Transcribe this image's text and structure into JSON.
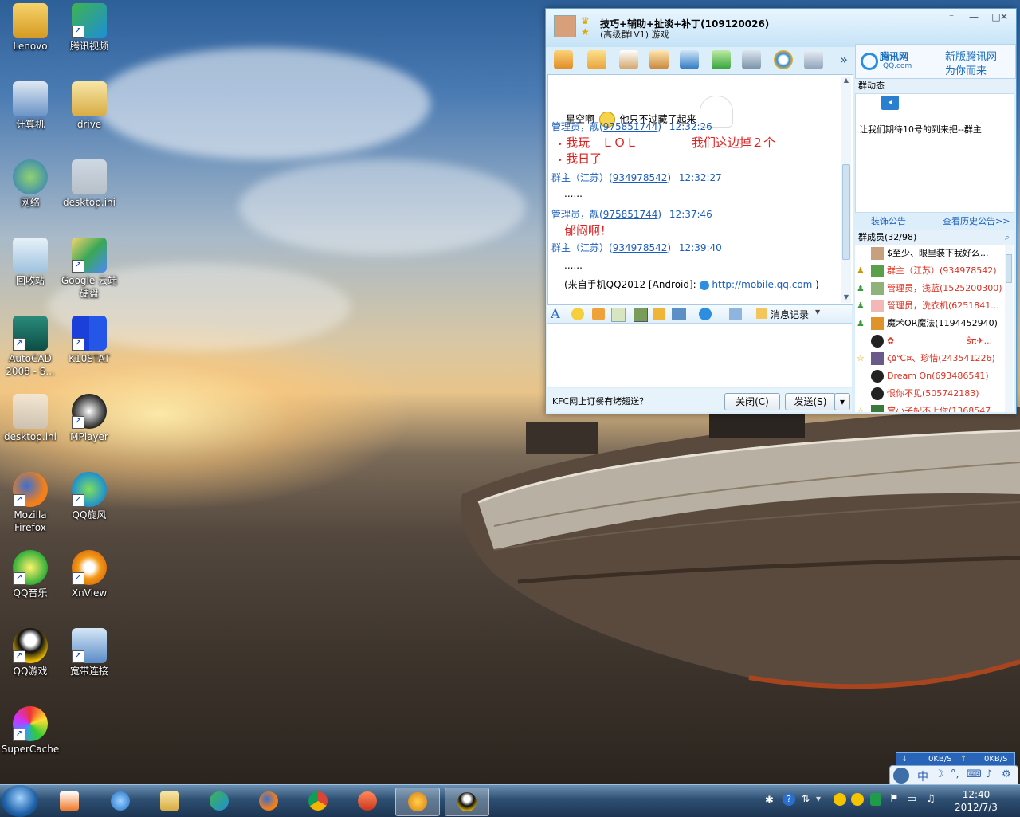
{
  "desktop": {
    "icons": [
      {
        "label": "Lenovo",
        "icon": "user-folder-icon"
      },
      {
        "label": "腾讯视频",
        "icon": "tencent-video-icon"
      },
      {
        "label": "计算机",
        "icon": "computer-icon"
      },
      {
        "label": "drive",
        "icon": "folder-icon"
      },
      {
        "label": "网络",
        "icon": "network-globe-icon"
      },
      {
        "label": "desktop.ini",
        "icon": "settings-file-icon"
      },
      {
        "label": "回收站",
        "icon": "recycle-bin-icon"
      },
      {
        "label": "Google 云端\n硬盘",
        "icon": "google-drive-icon"
      },
      {
        "label": "AutoCAD\n2008 - S...",
        "icon": "autocad-icon"
      },
      {
        "label": "K10STAT",
        "icon": "k10stat-icon"
      },
      {
        "label": "desktop.ini",
        "icon": "settings-file-icon"
      },
      {
        "label": "MPlayer",
        "icon": "mplayer-icon"
      },
      {
        "label": "Mozilla\nFirefox",
        "icon": "firefox-icon"
      },
      {
        "label": "QQ旋风",
        "icon": "qq-whirlwind-icon"
      },
      {
        "label": "QQ音乐",
        "icon": "qq-music-icon"
      },
      {
        "label": "XnView",
        "icon": "xnview-icon"
      },
      {
        "label": "QQ游戏",
        "icon": "qq-game-icon"
      },
      {
        "label": "宽带连接",
        "icon": "broadband-icon"
      },
      {
        "label": "SuperCache",
        "icon": "supercache-icon"
      }
    ]
  },
  "qq": {
    "group_name": "技巧+辅助+扯淡+补丁(109120026)",
    "group_sub": "(高级群LV1) 游戏",
    "chat": {
      "line1_name": "星空啊",
      "line1_text": "他只不过藏了起来",
      "m1_name": "管理员，靓(",
      "m1_uid": "975851744",
      "m1_close": ")",
      "m1_time": "12:32:26",
      "m1_text_a": "我玩　ＬＯＬ",
      "m1_text_b": "我们这边掉２个",
      "m1_text_c": "我日了",
      "m2_name": "群主（江苏）(",
      "m2_uid": "934978542",
      "m2_close": ")",
      "m2_time": "12:32:27",
      "m2_text": "......",
      "m3_name": "管理员，靓(",
      "m3_uid": "975851744",
      "m3_close": ")",
      "m3_time": "12:37:46",
      "m3_text": "郁闷啊！",
      "m4_name": "群主（江苏）(",
      "m4_uid": "934978542",
      "m4_close": ")",
      "m4_time": "12:39:40",
      "m4_text": "......",
      "m4_src": "(来自手机QQ2012 [Android]:",
      "m4_link": "http://mobile.qq.com",
      "m4_end": ")"
    },
    "fmt_history": "消息记录",
    "bottom_ad": "KFC网上订餐有烤翅送？",
    "close_btn": "关闭(C)",
    "send_btn": "发送(S)",
    "ad_line1": "新版腾讯网",
    "ad_line2": "为你而来",
    "ad_logo": "腾讯网",
    "ad_logo_sub": "QQ.com",
    "notice_header": "群动态",
    "notice_text": "让我们期待10号的到来把--群主",
    "decor_link": "装饰公告",
    "history_link": "查看历史公告>>",
    "members_header": "群成员(32/98)",
    "members": [
      "$至少、眼里装下我好么...",
      "群主（江苏）(934978542)",
      "管理员，浅蓝(1525200300)",
      "管理员，洗衣机(6251841...",
      "魔术OR魔法(1194452940)",
      "✿",
      "ζ۵℃¤、珍惜(243541226)",
      "Dream On(693486541)",
      "恨你不见(505742183)",
      "宫小子配不上你(1368547..."
    ],
    "member5_right": "ŝπ✈..."
  },
  "taskbar": {
    "time": "12:40",
    "date": "2012/7/3",
    "net_up": "0KB/S",
    "net_down": "0KB/S",
    "ime_label": "中"
  },
  "colors": {
    "accent": "#1a5ebf",
    "chat_red": "#e02020",
    "qq_frame": "#5a9bcf"
  }
}
